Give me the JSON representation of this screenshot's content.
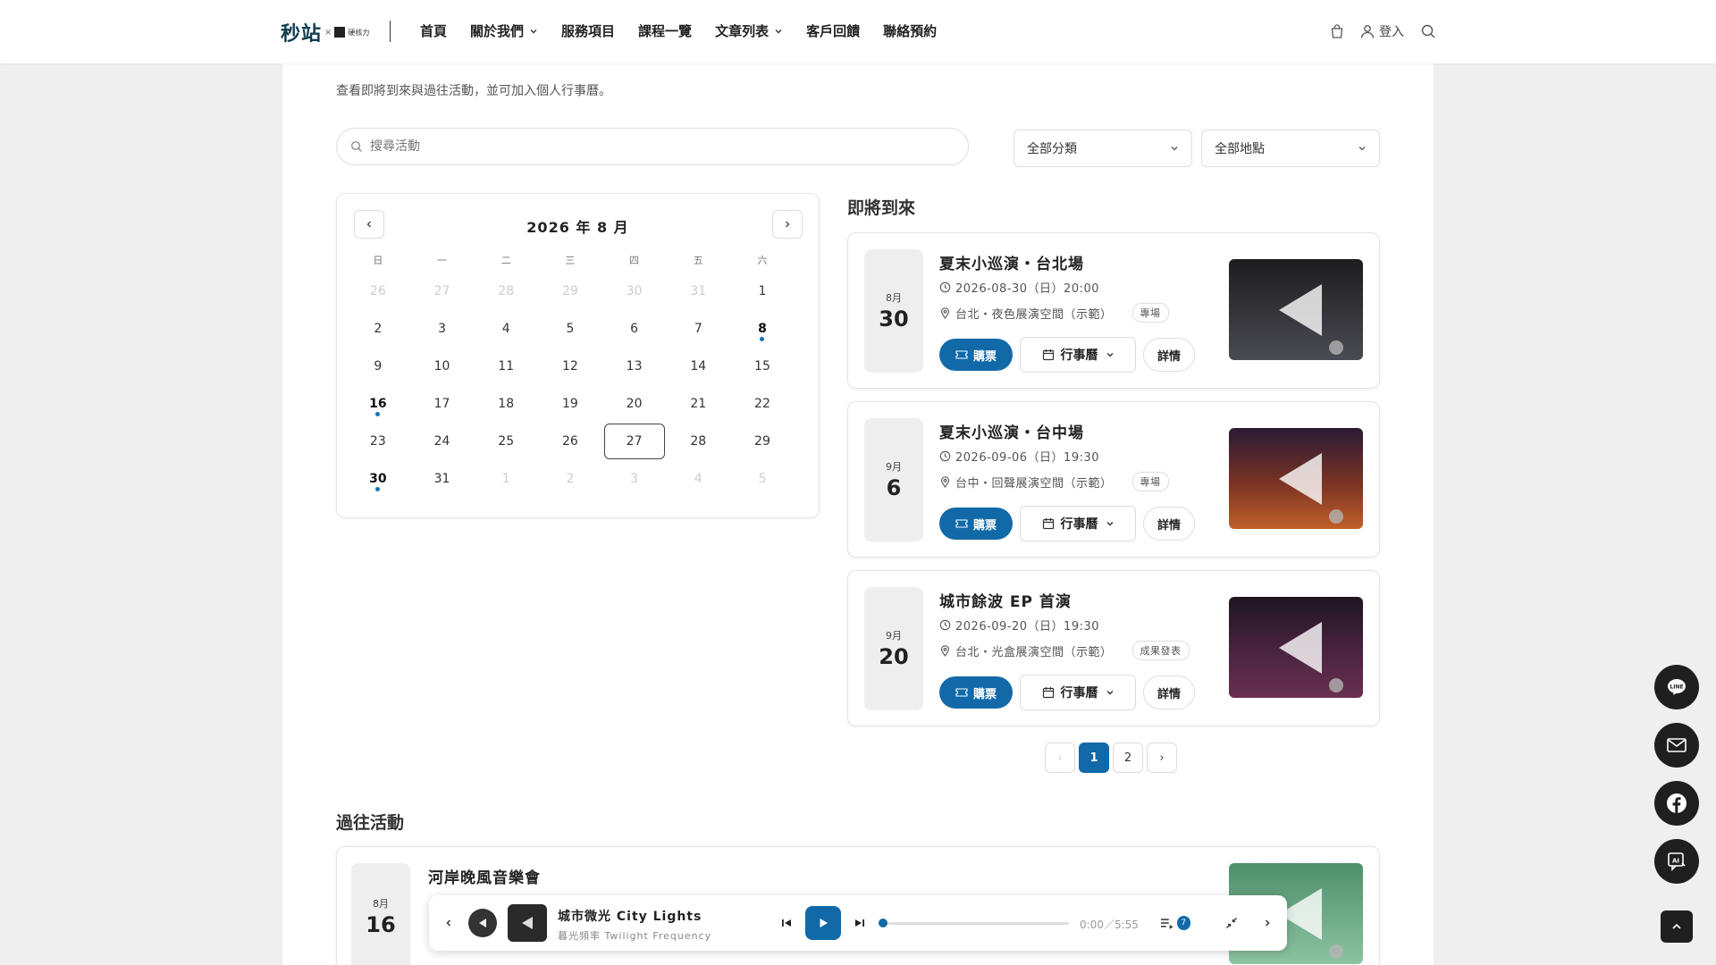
{
  "header": {
    "logo_main": "秒站",
    "logo_x": "×",
    "logo_sub": "硬核力",
    "nav": [
      {
        "label": "首頁"
      },
      {
        "label": "關於我們"
      },
      {
        "label": "服務項目"
      },
      {
        "label": "課程一覽"
      },
      {
        "label": "文章列表"
      },
      {
        "label": "客戶回饋"
      },
      {
        "label": "聯絡預約"
      }
    ],
    "login_label": "登入"
  },
  "page": {
    "subtitle": "查看即將到來與過往活動，並可加入個人行事曆。",
    "search_placeholder": "搜尋活動",
    "filter_category": "全部分類",
    "filter_location": "全部地點"
  },
  "calendar": {
    "title": "2026 年 8 月",
    "weekdays": [
      "日",
      "一",
      "二",
      "三",
      "四",
      "五",
      "六"
    ],
    "weeks": [
      [
        "26",
        "27",
        "28",
        "29",
        "30",
        "31",
        "1"
      ],
      [
        "2",
        "3",
        "4",
        "5",
        "6",
        "7",
        "8"
      ],
      [
        "9",
        "10",
        "11",
        "12",
        "13",
        "14",
        "15"
      ],
      [
        "16",
        "17",
        "18",
        "19",
        "20",
        "21",
        "22"
      ],
      [
        "23",
        "24",
        "25",
        "26",
        "27",
        "28",
        "29"
      ],
      [
        "30",
        "31",
        "1",
        "2",
        "3",
        "4",
        "5"
      ]
    ],
    "event_days": [
      "8",
      "16",
      "30"
    ],
    "today": "27",
    "event_color": "#1173b3"
  },
  "upcoming": {
    "title": "即將到來",
    "events": [
      {
        "month": "8月",
        "day": "30",
        "title": "夏末小巡演・台北場",
        "datetime": "2026-08-30（日）20:00",
        "location": "台北・夜色展演空間（示範）",
        "tag": "專場",
        "buy": "購票",
        "calendar": "行事曆",
        "detail": "詳情"
      },
      {
        "month": "9月",
        "day": "6",
        "title": "夏末小巡演・台中場",
        "datetime": "2026-09-06（日）19:30",
        "location": "台中・回聲展演空間（示範）",
        "tag": "專場",
        "buy": "購票",
        "calendar": "行事曆",
        "detail": "詳情"
      },
      {
        "month": "9月",
        "day": "20",
        "title": "城市餘波 EP 首演",
        "datetime": "2026-09-20（日）19:30",
        "location": "台北・光盒展演空間（示範）",
        "tag": "成果發表",
        "buy": "購票",
        "calendar": "行事曆",
        "detail": "詳情"
      }
    ]
  },
  "pagination": {
    "prev": "‹",
    "pages": [
      "1",
      "2"
    ],
    "current": "1",
    "next": "›"
  },
  "past": {
    "title": "過往活動",
    "events": [
      {
        "month": "8月",
        "day": "16",
        "title": "河岸晚風音樂會"
      }
    ]
  },
  "player": {
    "track_title": "城市微光 City Lights",
    "track_artist": "暮光頻率 Twilight Frequency",
    "time": "0:00／5:55",
    "progress": 0,
    "queue_count": "7"
  },
  "colors": {
    "accent": "#1269a8"
  }
}
